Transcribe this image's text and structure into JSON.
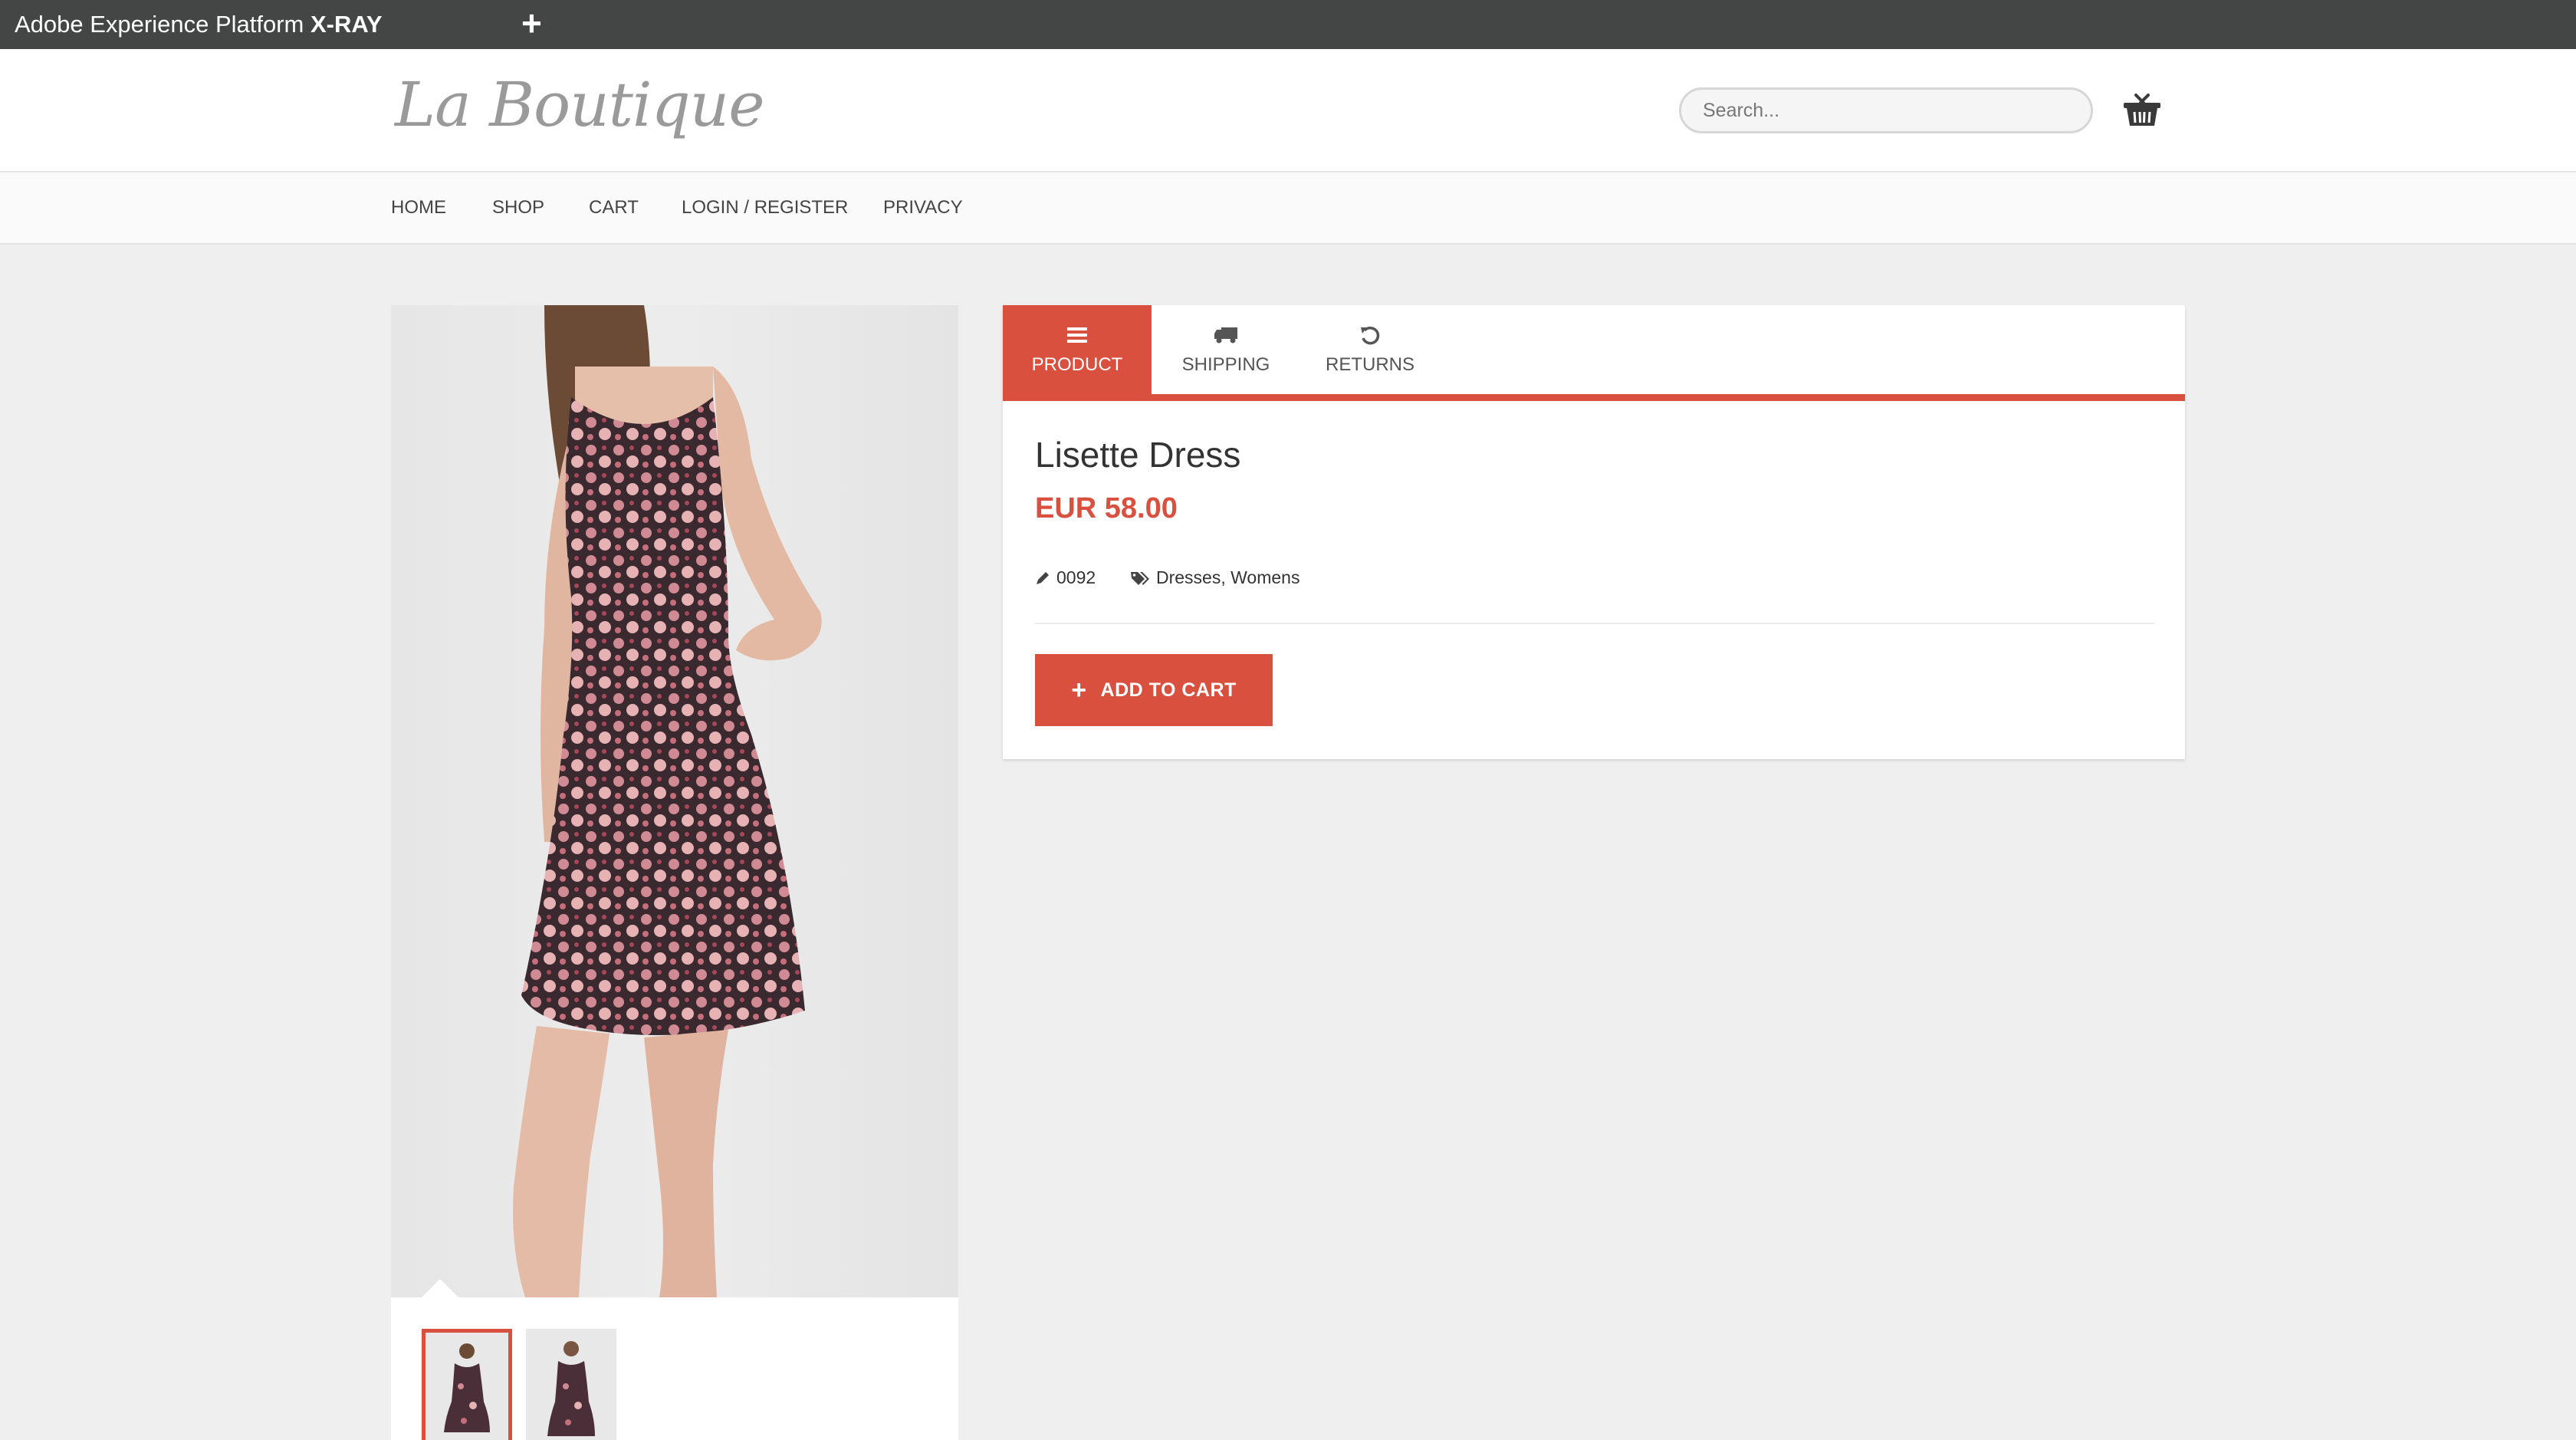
{
  "xray": {
    "title_prefix": "Adobe Experience Platform",
    "title_bold": "X-RAY",
    "add_symbol": "+"
  },
  "header": {
    "logo": "La Boutique",
    "search_placeholder": "Search...",
    "cart_icon": "basket-icon"
  },
  "nav": {
    "items": [
      "HOME",
      "SHOP",
      "CART",
      "LOGIN / REGISTER",
      "PRIVACY"
    ]
  },
  "tabs": [
    {
      "label": "PRODUCT",
      "icon": "menu-icon",
      "active": true
    },
    {
      "label": "SHIPPING",
      "icon": "truck-icon",
      "active": false
    },
    {
      "label": "RETURNS",
      "icon": "undo-icon",
      "active": false
    }
  ],
  "product": {
    "title": "Lisette Dress",
    "price": "EUR 58.00",
    "sku": "0092",
    "categories": "Dresses, Womens",
    "add_to_cart": "ADD TO CART",
    "add_symbol": "+"
  },
  "colors": {
    "accent": "#d9503f",
    "xray_bar": "#444545",
    "page_bg": "#efefef"
  }
}
